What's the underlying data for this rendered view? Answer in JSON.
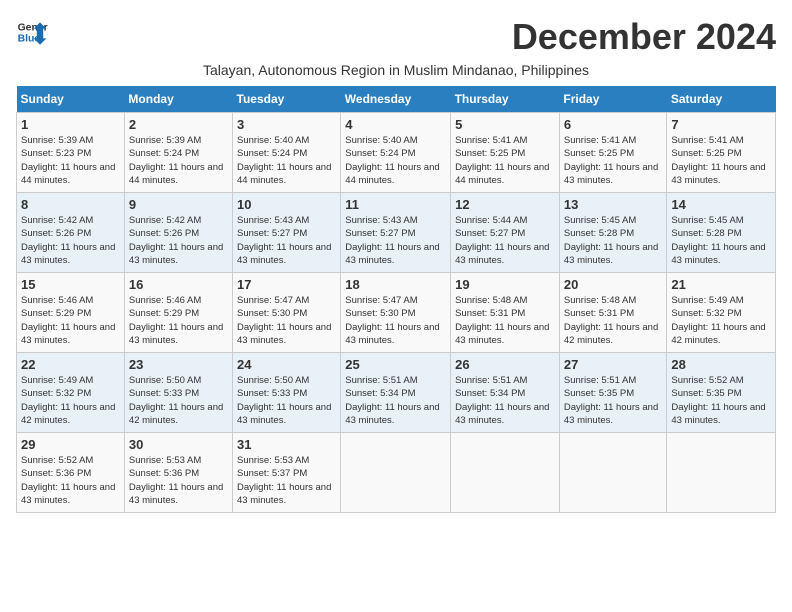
{
  "header": {
    "logo_line1": "General",
    "logo_line2": "Blue",
    "month_year": "December 2024",
    "location": "Talayan, Autonomous Region in Muslim Mindanao, Philippines"
  },
  "columns": [
    "Sunday",
    "Monday",
    "Tuesday",
    "Wednesday",
    "Thursday",
    "Friday",
    "Saturday"
  ],
  "weeks": [
    [
      {
        "day": "1",
        "sunrise": "5:39 AM",
        "sunset": "5:23 PM",
        "daylight": "11 hours and 44 minutes."
      },
      {
        "day": "2",
        "sunrise": "5:39 AM",
        "sunset": "5:24 PM",
        "daylight": "11 hours and 44 minutes."
      },
      {
        "day": "3",
        "sunrise": "5:40 AM",
        "sunset": "5:24 PM",
        "daylight": "11 hours and 44 minutes."
      },
      {
        "day": "4",
        "sunrise": "5:40 AM",
        "sunset": "5:24 PM",
        "daylight": "11 hours and 44 minutes."
      },
      {
        "day": "5",
        "sunrise": "5:41 AM",
        "sunset": "5:25 PM",
        "daylight": "11 hours and 44 minutes."
      },
      {
        "day": "6",
        "sunrise": "5:41 AM",
        "sunset": "5:25 PM",
        "daylight": "11 hours and 43 minutes."
      },
      {
        "day": "7",
        "sunrise": "5:41 AM",
        "sunset": "5:25 PM",
        "daylight": "11 hours and 43 minutes."
      }
    ],
    [
      {
        "day": "8",
        "sunrise": "5:42 AM",
        "sunset": "5:26 PM",
        "daylight": "11 hours and 43 minutes."
      },
      {
        "day": "9",
        "sunrise": "5:42 AM",
        "sunset": "5:26 PM",
        "daylight": "11 hours and 43 minutes."
      },
      {
        "day": "10",
        "sunrise": "5:43 AM",
        "sunset": "5:27 PM",
        "daylight": "11 hours and 43 minutes."
      },
      {
        "day": "11",
        "sunrise": "5:43 AM",
        "sunset": "5:27 PM",
        "daylight": "11 hours and 43 minutes."
      },
      {
        "day": "12",
        "sunrise": "5:44 AM",
        "sunset": "5:27 PM",
        "daylight": "11 hours and 43 minutes."
      },
      {
        "day": "13",
        "sunrise": "5:45 AM",
        "sunset": "5:28 PM",
        "daylight": "11 hours and 43 minutes."
      },
      {
        "day": "14",
        "sunrise": "5:45 AM",
        "sunset": "5:28 PM",
        "daylight": "11 hours and 43 minutes."
      }
    ],
    [
      {
        "day": "15",
        "sunrise": "5:46 AM",
        "sunset": "5:29 PM",
        "daylight": "11 hours and 43 minutes."
      },
      {
        "day": "16",
        "sunrise": "5:46 AM",
        "sunset": "5:29 PM",
        "daylight": "11 hours and 43 minutes."
      },
      {
        "day": "17",
        "sunrise": "5:47 AM",
        "sunset": "5:30 PM",
        "daylight": "11 hours and 43 minutes."
      },
      {
        "day": "18",
        "sunrise": "5:47 AM",
        "sunset": "5:30 PM",
        "daylight": "11 hours and 43 minutes."
      },
      {
        "day": "19",
        "sunrise": "5:48 AM",
        "sunset": "5:31 PM",
        "daylight": "11 hours and 43 minutes."
      },
      {
        "day": "20",
        "sunrise": "5:48 AM",
        "sunset": "5:31 PM",
        "daylight": "11 hours and 42 minutes."
      },
      {
        "day": "21",
        "sunrise": "5:49 AM",
        "sunset": "5:32 PM",
        "daylight": "11 hours and 42 minutes."
      }
    ],
    [
      {
        "day": "22",
        "sunrise": "5:49 AM",
        "sunset": "5:32 PM",
        "daylight": "11 hours and 42 minutes."
      },
      {
        "day": "23",
        "sunrise": "5:50 AM",
        "sunset": "5:33 PM",
        "daylight": "11 hours and 42 minutes."
      },
      {
        "day": "24",
        "sunrise": "5:50 AM",
        "sunset": "5:33 PM",
        "daylight": "11 hours and 43 minutes."
      },
      {
        "day": "25",
        "sunrise": "5:51 AM",
        "sunset": "5:34 PM",
        "daylight": "11 hours and 43 minutes."
      },
      {
        "day": "26",
        "sunrise": "5:51 AM",
        "sunset": "5:34 PM",
        "daylight": "11 hours and 43 minutes."
      },
      {
        "day": "27",
        "sunrise": "5:51 AM",
        "sunset": "5:35 PM",
        "daylight": "11 hours and 43 minutes."
      },
      {
        "day": "28",
        "sunrise": "5:52 AM",
        "sunset": "5:35 PM",
        "daylight": "11 hours and 43 minutes."
      }
    ],
    [
      {
        "day": "29",
        "sunrise": "5:52 AM",
        "sunset": "5:36 PM",
        "daylight": "11 hours and 43 minutes."
      },
      {
        "day": "30",
        "sunrise": "5:53 AM",
        "sunset": "5:36 PM",
        "daylight": "11 hours and 43 minutes."
      },
      {
        "day": "31",
        "sunrise": "5:53 AM",
        "sunset": "5:37 PM",
        "daylight": "11 hours and 43 minutes."
      },
      null,
      null,
      null,
      null
    ]
  ]
}
